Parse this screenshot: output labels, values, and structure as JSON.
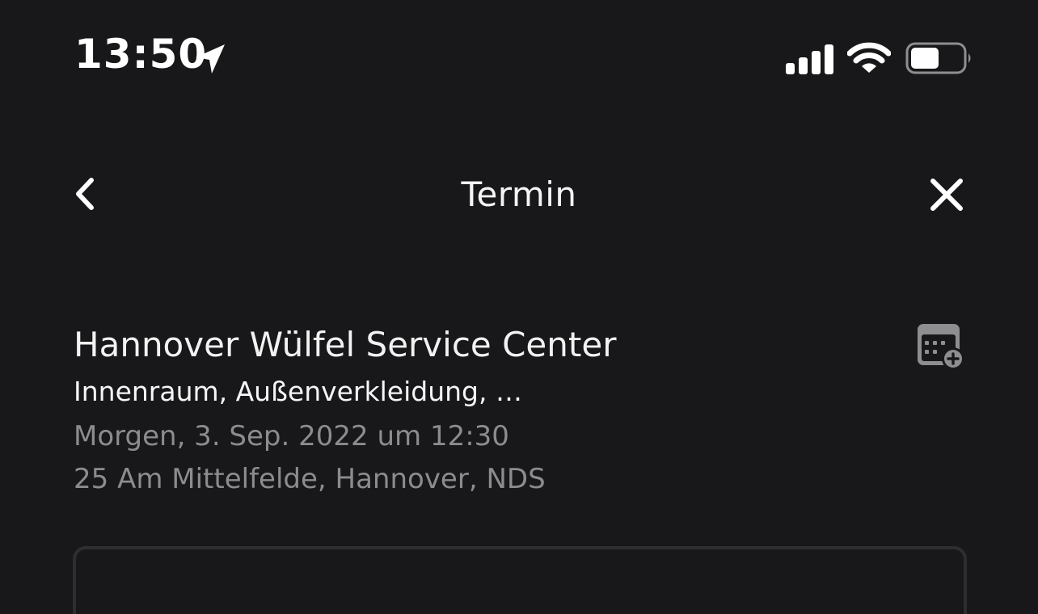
{
  "status_bar": {
    "time": "13:50",
    "icons": [
      "location-arrow-icon",
      "cellular-signal-icon",
      "wifi-icon",
      "battery-icon"
    ],
    "battery_level": 0.5
  },
  "nav": {
    "title": "Termin",
    "back_icon": "chevron-left-icon",
    "close_icon": "close-icon"
  },
  "appointment": {
    "center_name": "Hannover Wülfel Service Center",
    "services": "Innenraum, Außenverkleidung, …",
    "datetime": "Morgen, 3. Sep. 2022 um 12:30",
    "address": "25 Am Mittelfelde, Hannover, NDS",
    "calendar_icon": "calendar-add-icon"
  },
  "colors": {
    "background": "#18181a",
    "primary_text": "#f2f2f2",
    "secondary_text": "#8c8c8e",
    "icon_gray": "#8e8e90",
    "card_border": "#2e2e30"
  }
}
